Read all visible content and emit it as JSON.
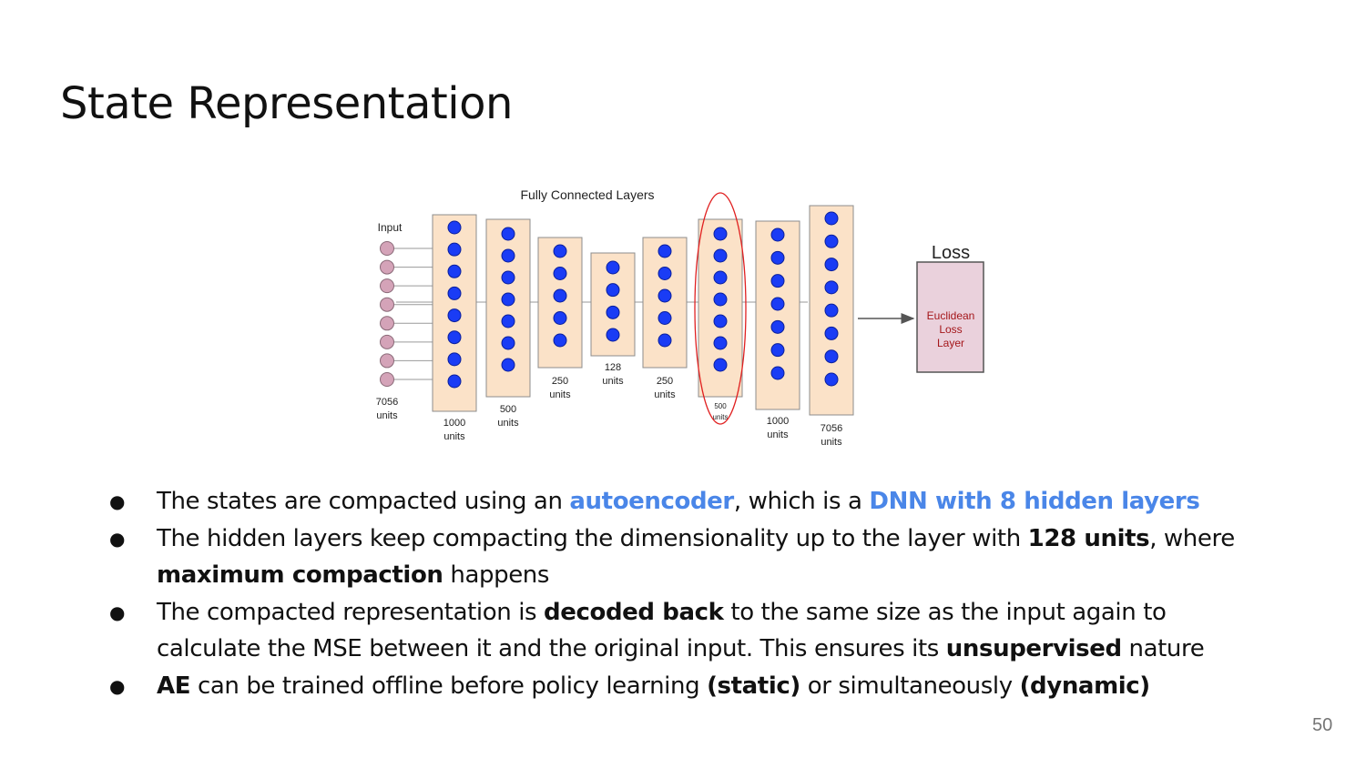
{
  "slide": {
    "title": "State Representation",
    "page_number": "50"
  },
  "diagram": {
    "header": "Fully Connected Layers",
    "input_label": "Input",
    "layers": [
      {
        "label_top": "7056",
        "label_bottom": "units",
        "nodes": 8
      },
      {
        "label_top": "1000",
        "label_bottom": "units",
        "nodes": 8
      },
      {
        "label_top": "500",
        "label_bottom": "units",
        "nodes": 7
      },
      {
        "label_top": "250",
        "label_bottom": "units",
        "nodes": 5
      },
      {
        "label_top": "128",
        "label_bottom": "units",
        "nodes": 4
      },
      {
        "label_top": "250",
        "label_bottom": "units",
        "nodes": 5
      },
      {
        "label_top": "500",
        "label_bottom": "units",
        "nodes": 7
      },
      {
        "label_top": "1000",
        "label_bottom": "units",
        "nodes": 7
      },
      {
        "label_top": "7056",
        "label_bottom": "units",
        "nodes": 8
      }
    ],
    "loss_title": "Loss",
    "loss_box_lines": [
      "Euclidean",
      "Loss",
      "Layer"
    ],
    "colors": {
      "node": "#1a3cf5",
      "input_node": "#d4a3b8",
      "layer_fill": "#fbe2c8",
      "loss_fill": "#ead1dc",
      "loss_text": "#a4161a",
      "highlight_ring": "#e02020"
    }
  },
  "bullets": [
    {
      "parts": [
        {
          "t": "The states are compacted using an "
        },
        {
          "t": "autoencoder",
          "s": "hl"
        },
        {
          "t": ", which is a "
        },
        {
          "t": "DNN with 8 hidden layers",
          "s": "hl"
        }
      ]
    },
    {
      "parts": [
        {
          "t": "The hidden layers keep compacting the dimensionality up to the layer with "
        },
        {
          "t": "128 units",
          "s": "b"
        },
        {
          "t": ", where "
        },
        {
          "t": "maximum compaction",
          "s": "b"
        },
        {
          "t": " happens"
        }
      ]
    },
    {
      "parts": [
        {
          "t": "The compacted representation is "
        },
        {
          "t": "decoded back",
          "s": "b"
        },
        {
          "t": " to the same size as the input again to calculate the MSE between it and the original input. This ensures its "
        },
        {
          "t": "unsupervised",
          "s": "b"
        },
        {
          "t": " nature"
        }
      ]
    },
    {
      "parts": [
        {
          "t": "AE",
          "s": "b"
        },
        {
          "t": " can be trained offline before policy learning "
        },
        {
          "t": "(static)",
          "s": "b"
        },
        {
          "t": " or simultaneously "
        },
        {
          "t": "(dynamic)",
          "s": "b"
        }
      ]
    }
  ]
}
